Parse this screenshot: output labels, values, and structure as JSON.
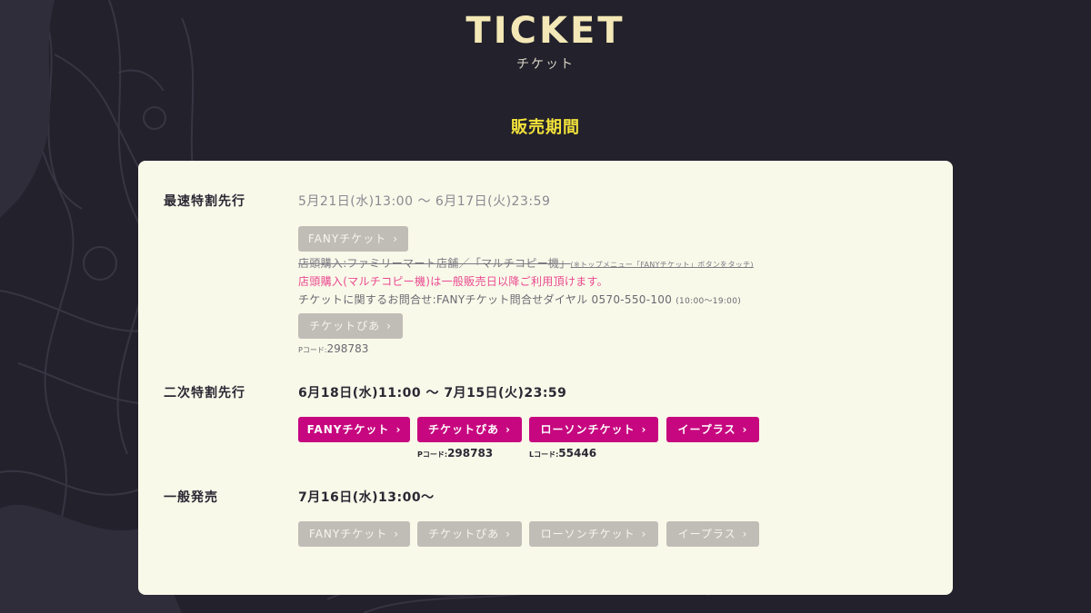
{
  "header": {
    "title": "TICKET",
    "subtitle": "チケット"
  },
  "period_heading": "販売期間",
  "sections": {
    "fastest": {
      "label": "最速特割先行",
      "date": "5月21日(水)13:00 〜 6月17日(火)23:59",
      "button_fany": "FANYチケット",
      "strike_note_main": "店頭購入:ファミリーマート店舗／「マルチコピー機」",
      "strike_note_small": "(※トップメニュー「FANYチケット」ボタンをタッチ)",
      "pink_note": "店頭購入(マルチコピー機)は一般販売日以降ご利用頂けます。",
      "inquiry_main": "チケットに関するお問合せ:FANYチケット問合せダイヤル 0570-550-100",
      "inquiry_hours": "(10:00〜19:00)",
      "button_pia": "チケットぴあ",
      "pcode_prefix": "Pコード:",
      "pcode_value": "298783"
    },
    "second": {
      "label": "二次特割先行",
      "date": "6月18日(水)11:00 〜 7月15日(火)23:59",
      "buttons": [
        "FANYチケット",
        "チケットぴあ",
        "ローソンチケット",
        "イープラス"
      ],
      "pcode_prefix": "Pコード:",
      "pcode_value": "298783",
      "lcode_prefix": "Lコード:",
      "lcode_value": "55446"
    },
    "general": {
      "label": "一般発売",
      "date": "7月16日(水)13:00〜",
      "buttons": [
        "FANYチケット",
        "チケットぴあ",
        "ローソンチケット",
        "イープラス"
      ]
    }
  },
  "colors": {
    "background": "#23212c",
    "card": "#f9f9ea",
    "title": "#f3e8b6",
    "period_heading": "#f2e23a",
    "active_button": "#c6077f",
    "disabled_button": "#c0bdb7",
    "notice_pink": "#ea4a8f"
  },
  "icons": {
    "button_arrow": "chevron-right-icon"
  }
}
